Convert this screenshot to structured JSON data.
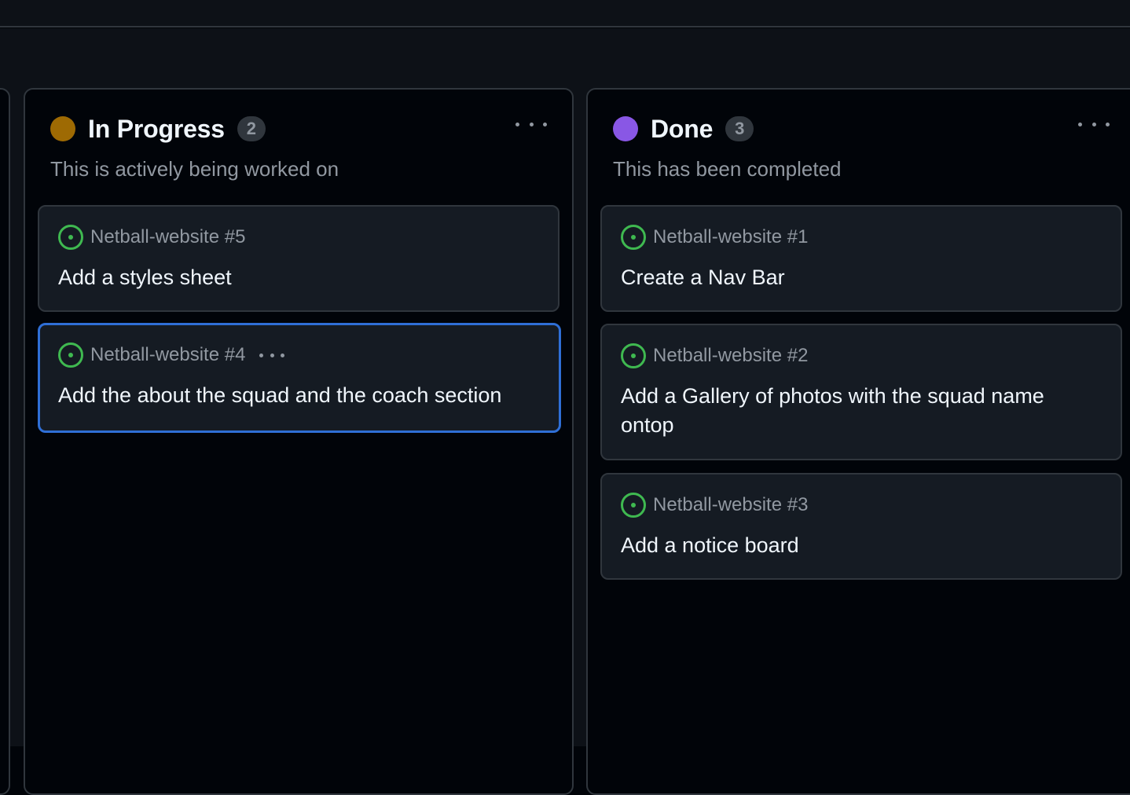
{
  "colors": {
    "in_progress": "#9e6a03",
    "done": "#8957e5",
    "issue_open": "#3fb950",
    "selection": "#2f6fd6"
  },
  "columns": [
    {
      "title": "In Progress",
      "count": "2",
      "description": "This is actively being worked on",
      "cards": [
        {
          "repo": "Netball-website #5",
          "title": "Add a styles sheet",
          "icon": "issue-open-icon"
        },
        {
          "repo": "Netball-website #4",
          "title": "Add the about the squad and the coach section",
          "icon": "issue-open-icon",
          "selected": true
        }
      ]
    },
    {
      "title": "Done",
      "count": "3",
      "description": "This has been completed",
      "cards": [
        {
          "repo": "Netball-website #1",
          "title": "Create a Nav Bar",
          "icon": "issue-open-icon"
        },
        {
          "repo": "Netball-website #2",
          "title": "Add a Gallery of photos with the squad name ontop",
          "icon": "issue-open-icon"
        },
        {
          "repo": "Netball-website #3",
          "title": "Add a notice board",
          "icon": "issue-open-icon"
        }
      ]
    }
  ]
}
